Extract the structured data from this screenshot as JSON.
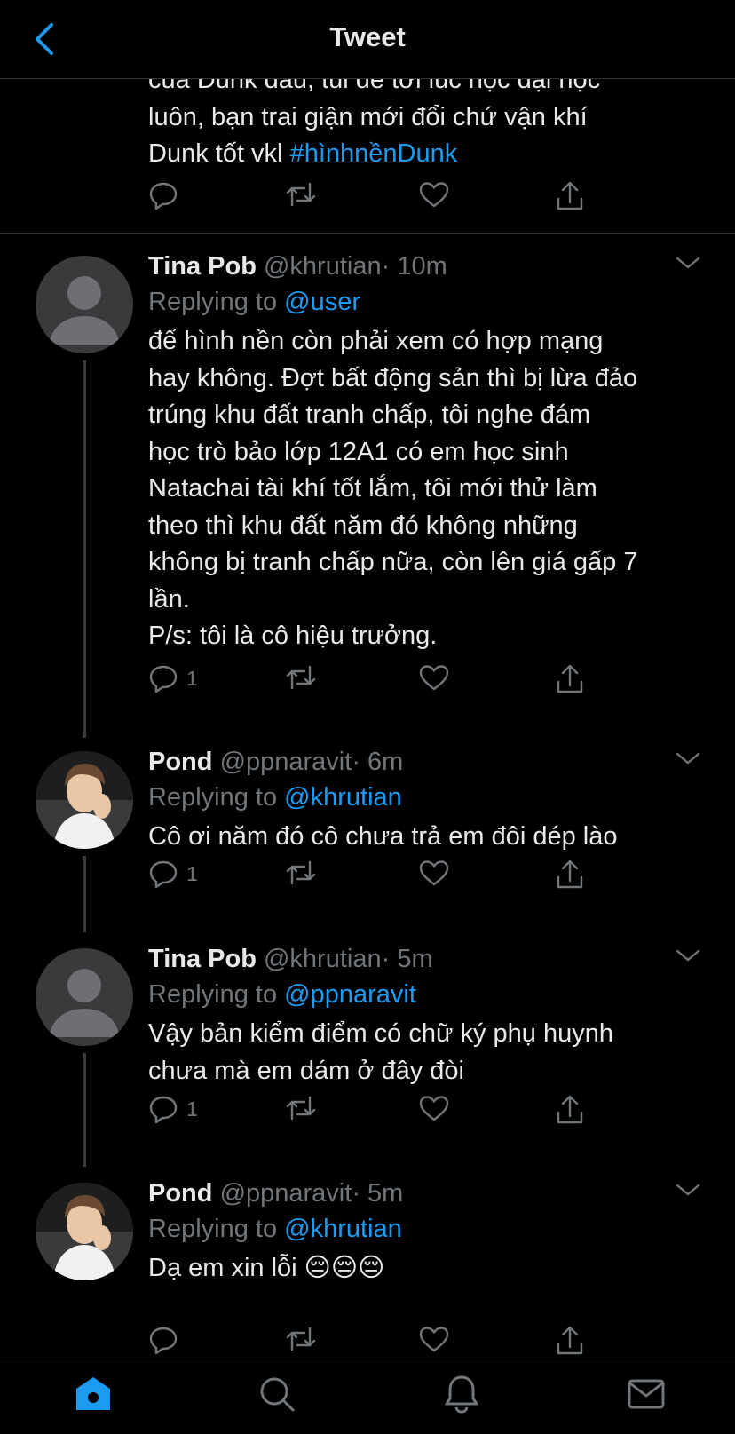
{
  "header": {
    "title": "Tweet"
  },
  "top_tweet": {
    "text_plain": "của Dunk đâu, tui để tới lúc học đại học\nluôn, bạn trai giận mới đổi chứ vận khí\nDunk tốt vkl ",
    "hashtag": "#hìnhnềnDunk"
  },
  "replies": [
    {
      "name": "Tina Pob",
      "handle": "@khrutian",
      "time": "· 10m",
      "replying_prefix": "Replying to",
      "replying_to": "@user",
      "text": "để hình nền còn phải xem có hợp mạng\nhay không. Đợt bất động sản thì bị lừa đảo\ntrúng khu đất tranh chấp, tôi nghe đám\nhọc trò bảo lớp 12A1 có em học sinh\nNatachai tài khí tốt lắm, tôi mới thử làm\ntheo thì khu đất năm đó không những\nkhông bị tranh chấp nữa, còn lên giá gấp 7\nlần.\nP/s: tôi là cô hiệu trưởng.",
      "reply_count": "1",
      "avatar": "default"
    },
    {
      "name": "Pond",
      "handle": "@ppnaravit",
      "time": "· 6m",
      "replying_prefix": "Replying to",
      "replying_to": "@khrutian",
      "text": "Cô ơi năm đó cô chưa trả em đôi dép lào",
      "reply_count": "1",
      "avatar": "photo"
    },
    {
      "name": "Tina Pob",
      "handle": "@khrutian",
      "time": "· 5m",
      "replying_prefix": "Replying to",
      "replying_to": "@ppnaravit",
      "text": "Vậy bản kiểm điểm có chữ ký phụ huynh\nchưa mà em dám ở đây đòi",
      "reply_count": "1",
      "avatar": "default"
    },
    {
      "name": "Pond",
      "handle": "@ppnaravit",
      "time": "· 5m",
      "replying_prefix": "Replying to",
      "replying_to": "@khrutian",
      "text": "Dạ em xin lỗi 😔😔😔",
      "reply_count": "",
      "avatar": "photo"
    }
  ],
  "icons": {
    "back": "chevron-left-icon",
    "reply": "reply-icon",
    "retweet": "retweet-icon",
    "like": "heart-icon",
    "share": "share-icon",
    "more": "chevron-down-icon",
    "home": "home-icon",
    "search": "search-icon",
    "notifications": "bell-icon",
    "messages": "mail-icon"
  },
  "colors": {
    "accent": "#1d9bf0",
    "background": "#000000",
    "text": "#e7e9ea",
    "muted": "#71767b",
    "divider": "#2f3336"
  }
}
